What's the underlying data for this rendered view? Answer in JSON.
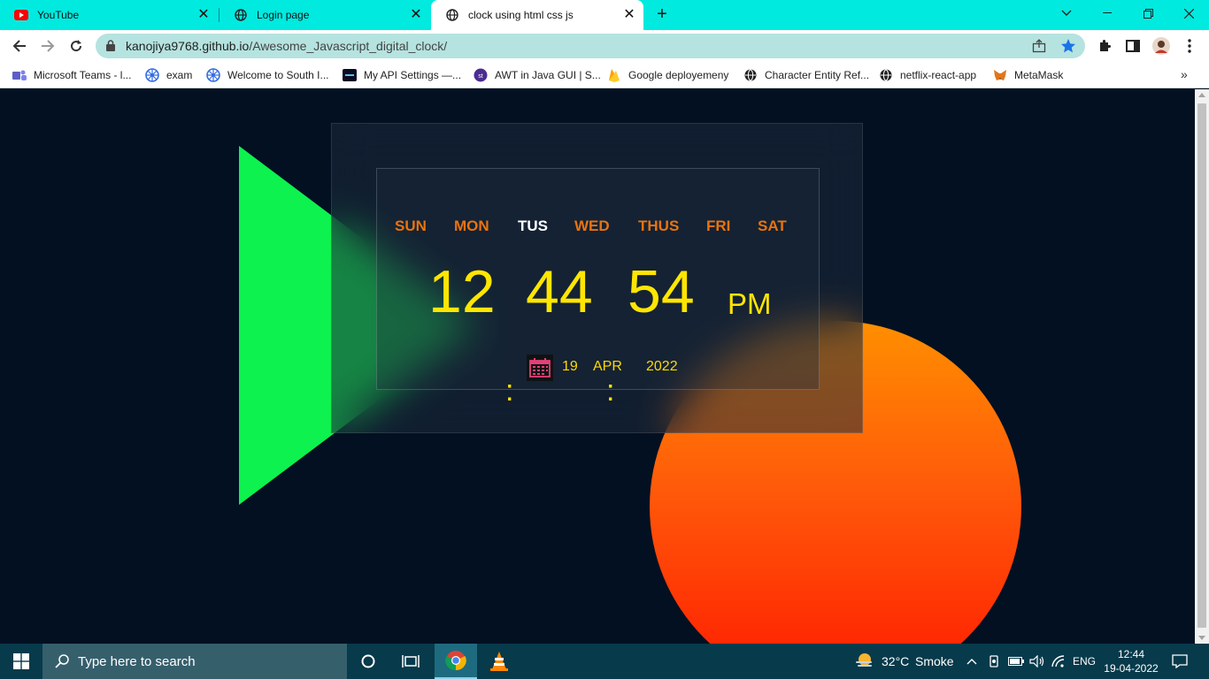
{
  "browser": {
    "tabs": [
      {
        "title": "YouTube",
        "icon": "youtube-icon"
      },
      {
        "title": "Login page",
        "icon": "globe-icon"
      },
      {
        "title": "clock using html css js",
        "icon": "globe-icon",
        "active": true
      }
    ],
    "url_host": "kanojiya9768.github.io",
    "url_path": "/Awesome_Javascript_digital_clock/",
    "bookmarks": [
      {
        "label": "Microsoft Teams - l...",
        "icon": "teams-icon"
      },
      {
        "label": "exam",
        "icon": "kubernetes-icon"
      },
      {
        "label": "Welcome to South I...",
        "icon": "kubernetes-icon"
      },
      {
        "label": "My API Settings —...",
        "icon": "dev-icon"
      },
      {
        "label": "AWT in Java GUI | S...",
        "icon": "st-icon"
      },
      {
        "label": "Google deployemeny",
        "icon": "firebase-icon"
      },
      {
        "label": "Character Entity Ref...",
        "icon": "globe-icon"
      },
      {
        "label": "netflix-react-app",
        "icon": "globe-icon"
      },
      {
        "label": "MetaMask",
        "icon": "metamask-icon"
      }
    ],
    "bookmarks_more": "»"
  },
  "clock": {
    "days": [
      "SUN",
      "MON",
      "TUS",
      "WED",
      "THUS",
      "FRI",
      "SAT"
    ],
    "active_day": "TUS",
    "hours": "12",
    "minutes": "44",
    "seconds": "54",
    "separator": ":",
    "ampm": "PM",
    "date_day": "19",
    "date_month": "APR",
    "date_year": "2022",
    "colors": {
      "digits": "#ffe600",
      "day": "#e9730e",
      "active_day": "#ffffff",
      "triangle": "#0df24e",
      "circle_top": "#ff8f00",
      "circle_bottom": "#ff1a00"
    }
  },
  "taskbar": {
    "search_placeholder": "Type here to search",
    "weather_temp": "32°C",
    "weather_desc": "Smoke",
    "language": "ENG",
    "time": "12:44",
    "date": "19-04-2022"
  }
}
